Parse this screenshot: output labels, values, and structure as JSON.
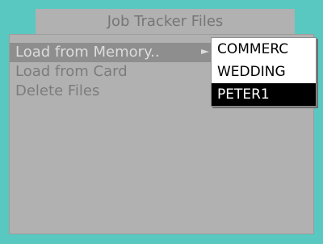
{
  "window": {
    "title": "Job Tracker Files"
  },
  "menu": {
    "items": [
      {
        "label": "Load from Memory..",
        "selected": true
      },
      {
        "label": "Load from Card",
        "selected": false
      },
      {
        "label": "Delete Files",
        "selected": false
      }
    ]
  },
  "submenu": {
    "items": [
      {
        "label": "COMMERC",
        "active": false
      },
      {
        "label": "WEDDING",
        "active": false
      },
      {
        "label": "PETER1",
        "active": true
      }
    ]
  },
  "colors": {
    "background": "#58c8c0",
    "panel": "#b1b1b1",
    "selection": "#8e8e8e",
    "active_item": "#000000"
  },
  "icons": {
    "submenu_indicator": "triangle-right-icon"
  }
}
